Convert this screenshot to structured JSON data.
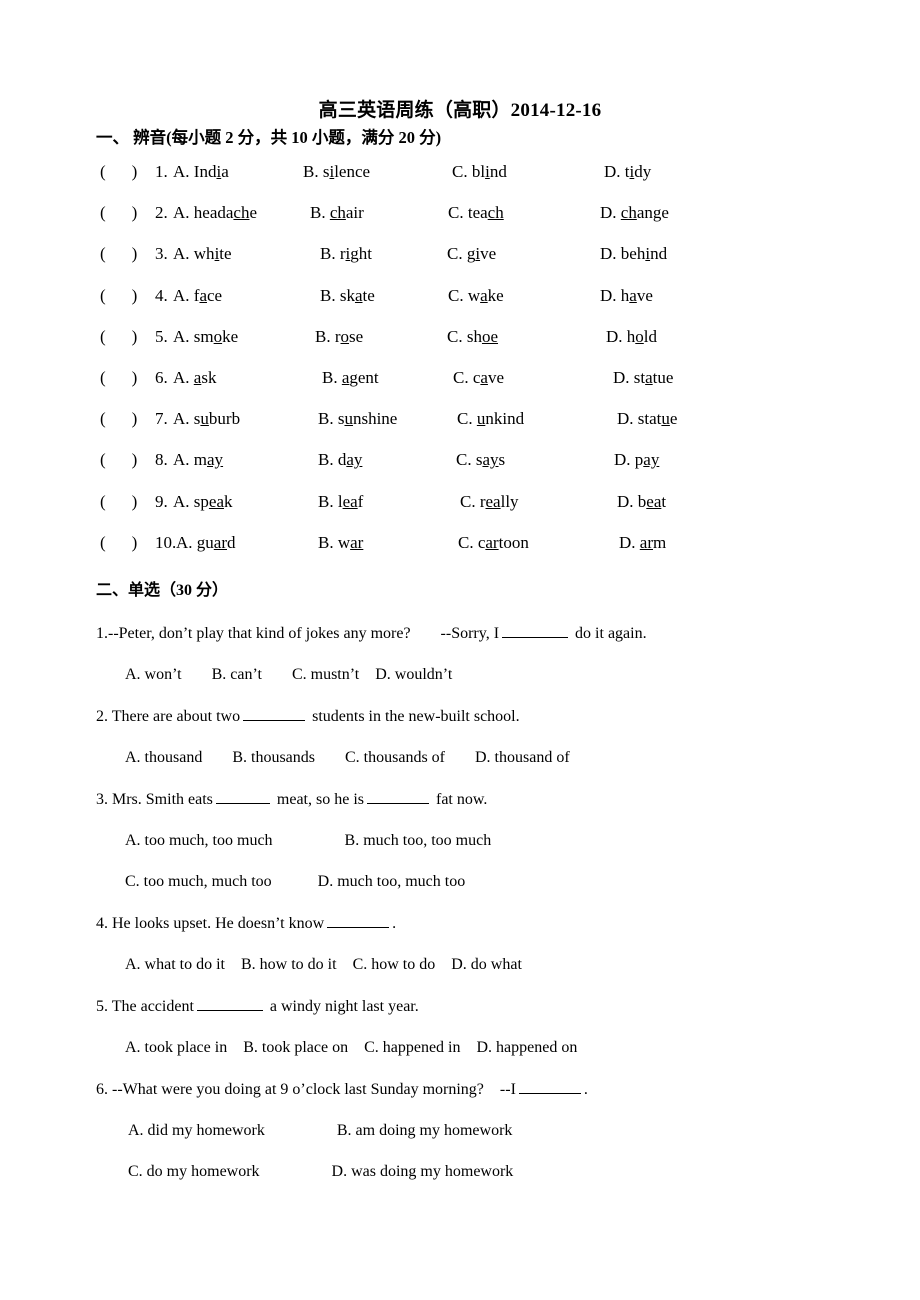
{
  "document": {
    "title": "高三英语周练（高职）2014-12-16"
  },
  "section1": {
    "heading": "一、 辨音(每小题 2 分，共 10 小题，满分 20 分)",
    "paren_left": "(",
    "paren_right": ")",
    "rows": [
      {
        "num": "1.",
        "a": {
          "label": "A.",
          "pre": "Ind",
          "mid": "i",
          "post": "a"
        },
        "b": {
          "label": "B.",
          "pre": "s",
          "mid": "i",
          "post": "lence"
        },
        "c": {
          "label": "C.",
          "pre": "bl",
          "mid": "i",
          "post": "nd"
        },
        "d": {
          "label": "D.",
          "pre": "t",
          "mid": "i",
          "post": "dy"
        }
      },
      {
        "num": "2.",
        "a": {
          "label": "A.",
          "pre": "heada",
          "mid": "ch",
          "post": "e"
        },
        "b": {
          "label": "B.",
          "pre": "",
          "mid": "ch",
          "post": "air"
        },
        "c": {
          "label": "C.",
          "pre": "tea",
          "mid": "ch",
          "post": ""
        },
        "d": {
          "label": "D.",
          "pre": "",
          "mid": "ch",
          "post": "ange"
        }
      },
      {
        "num": "3.",
        "a": {
          "label": "A.",
          "pre": "wh",
          "mid": "i",
          "post": "te"
        },
        "b": {
          "label": "B.",
          "pre": "r",
          "mid": "i",
          "post": "ght"
        },
        "c": {
          "label": "C.",
          "pre": "g",
          "mid": "i",
          "post": "ve"
        },
        "d": {
          "label": "D.",
          "pre": "beh",
          "mid": "i",
          "post": "nd"
        }
      },
      {
        "num": "4.",
        "a": {
          "label": "A.",
          "pre": "f",
          "mid": "a",
          "post": "ce"
        },
        "b": {
          "label": "B.",
          "pre": "sk",
          "mid": "a",
          "post": "te"
        },
        "c": {
          "label": "C.",
          "pre": "w",
          "mid": "a",
          "post": "ke"
        },
        "d": {
          "label": "D.",
          "pre": "h",
          "mid": "a",
          "post": "ve"
        }
      },
      {
        "num": "5.",
        "a": {
          "label": "A.",
          "pre": "sm",
          "mid": "o",
          "post": "ke"
        },
        "b": {
          "label": "B.",
          "pre": "r",
          "mid": "o",
          "post": "se"
        },
        "c": {
          "label": "C.",
          "pre": "sh",
          "mid": "oe",
          "post": ""
        },
        "d": {
          "label": "D.",
          "pre": "h",
          "mid": "o",
          "post": "ld"
        }
      },
      {
        "num": "6.",
        "a": {
          "label": "A.",
          "pre": "",
          "mid": "a",
          "post": "sk"
        },
        "b": {
          "label": "B.",
          "pre": "",
          "mid": "a",
          "post": "gent"
        },
        "c": {
          "label": "C.",
          "pre": "c",
          "mid": "a",
          "post": "ve"
        },
        "d": {
          "label": "D.",
          "pre": "st",
          "mid": "a",
          "post": "tue"
        }
      },
      {
        "num": "7.",
        "a": {
          "label": "A.",
          "pre": "s",
          "mid": "u",
          "post": "burb"
        },
        "b": {
          "label": "B.",
          "pre": "s",
          "mid": "u",
          "post": "nshine"
        },
        "c": {
          "label": "C.",
          "pre": "",
          "mid": "u",
          "post": "nkind"
        },
        "d": {
          "label": "D.",
          "pre": "stat",
          "mid": "u",
          "post": "e"
        }
      },
      {
        "num": "8.",
        "a": {
          "label": "A.",
          "pre": "m",
          "mid": "ay",
          "post": ""
        },
        "b": {
          "label": "B.",
          "pre": "d",
          "mid": "ay",
          "post": ""
        },
        "c": {
          "label": "C.",
          "pre": "s",
          "mid": "ay",
          "post": "s"
        },
        "d": {
          "label": "D.",
          "pre": "p",
          "mid": "ay",
          "post": ""
        }
      },
      {
        "num": "9.",
        "a": {
          "label": "A.",
          "pre": "sp",
          "mid": "ea",
          "post": "k"
        },
        "b": {
          "label": "B.",
          "pre": "l",
          "mid": "ea",
          "post": "f"
        },
        "c": {
          "label": "C.",
          "pre": "r",
          "mid": "ea",
          "post": "lly"
        },
        "d": {
          "label": "D.",
          "pre": "b",
          "mid": "ea",
          "post": "t"
        }
      },
      {
        "num": "10.",
        "a": {
          "label": "A.",
          "pre": "gu",
          "mid": "ar",
          "post": "d"
        },
        "b": {
          "label": "B.",
          "pre": "w",
          "mid": "ar",
          "post": ""
        },
        "c": {
          "label": "C.",
          "pre": "c",
          "mid": "ar",
          "post": "toon"
        },
        "d": {
          "label": "D.",
          "pre": "",
          "mid": "ar",
          "post": "m"
        }
      }
    ]
  },
  "section2": {
    "heading": "二、单选（30 分）",
    "questions": [
      {
        "stem_pre": "1.--Peter, don’t play that kind of jokes any more?",
        "stem_mid": "--Sorry, I",
        "stem_post": "do it again.",
        "options": [
          "A. won’t",
          "B. can’t",
          "C. mustn’t",
          "D. wouldn’t"
        ]
      },
      {
        "stem_pre": "2. There are about two",
        "stem_post": "students in the new-built school.",
        "options": [
          "A. thousand",
          "B. thousands",
          "C. thousands of",
          "D. thousand of"
        ]
      },
      {
        "stem_pre": "3. Mrs. Smith eats",
        "stem_mid": "meat, so he is",
        "stem_post": "fat now.",
        "options_line1": [
          "A. too much, too much",
          "B. much too, too much"
        ],
        "options_line2": [
          "C. too much, much too",
          "D. much too, much too"
        ]
      },
      {
        "stem_pre": "4. He looks upset. He doesn’t know",
        "stem_post": ".",
        "options": [
          "A. what to do it",
          "B. how to do it",
          "C. how to do",
          "D. do what"
        ]
      },
      {
        "stem_pre": "5. The accident",
        "stem_post": "a windy night last year.",
        "options": [
          "A. took place in",
          "B. took place on",
          "C. happened in",
          "D. happened on"
        ]
      },
      {
        "stem_pre": "6. --What were you doing at 9 o’clock last Sunday morning?",
        "stem_mid": "--I",
        "stem_post": ".",
        "options_line1": [
          "A. did my homework",
          "B. am doing my homework"
        ],
        "options_line2": [
          "C. do my homework",
          "D. was doing my homework"
        ]
      }
    ]
  }
}
